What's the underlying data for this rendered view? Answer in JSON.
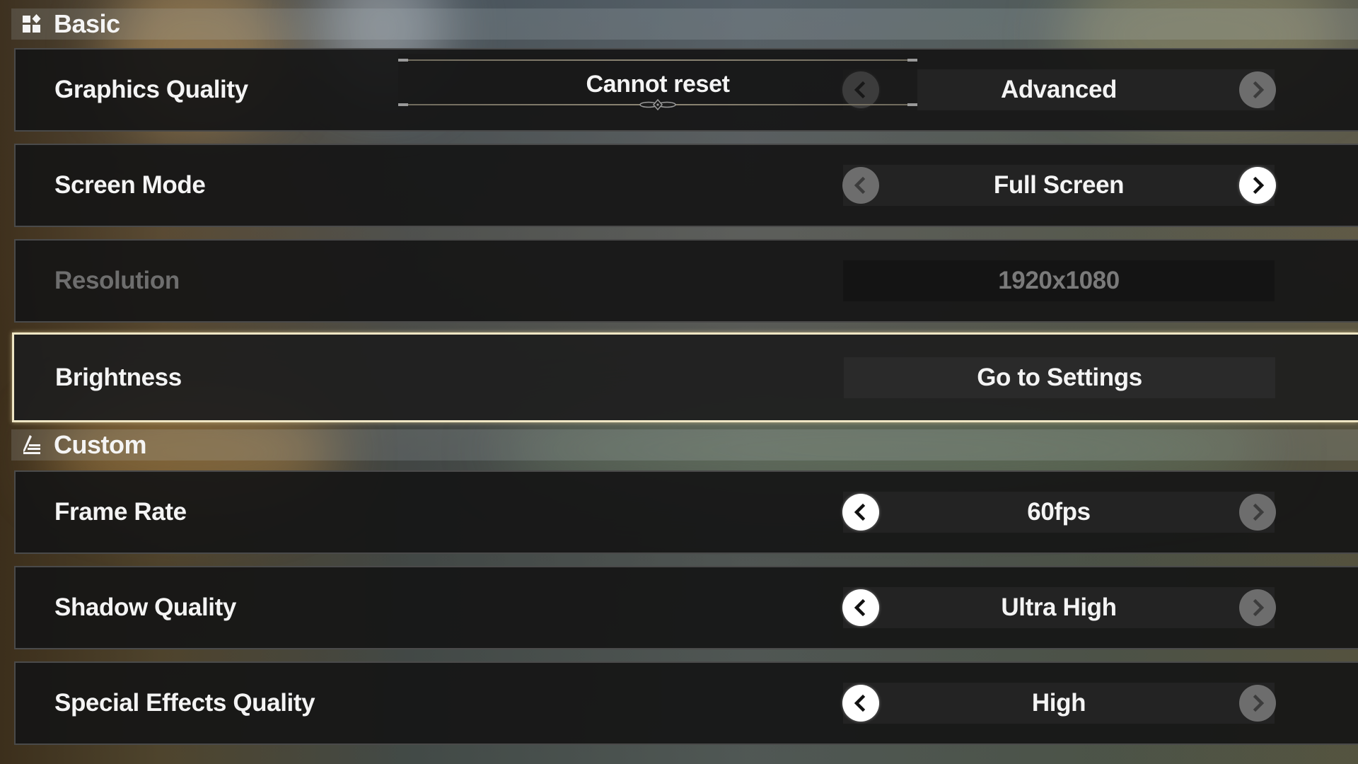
{
  "sections": [
    {
      "title": "Basic",
      "icon": "grid-diamond-icon",
      "rows": [
        {
          "label": "Graphics Quality",
          "type": "selector",
          "value": "Advanced",
          "left_enabled": true,
          "right_enabled": false,
          "tooltip": "Cannot reset"
        },
        {
          "label": "Screen Mode",
          "type": "selector",
          "value": "Full Screen",
          "left_enabled": false,
          "right_enabled": true
        },
        {
          "label": "Resolution",
          "type": "readonly",
          "value": "1920x1080",
          "disabled": true
        },
        {
          "label": "Brightness",
          "type": "button",
          "value": "Go to Settings",
          "selected": true
        }
      ]
    },
    {
      "title": "Custom",
      "icon": "pencil-lines-icon",
      "rows": [
        {
          "label": "Frame Rate",
          "type": "selector",
          "value": "60fps",
          "left_enabled": true,
          "right_enabled": false
        },
        {
          "label": "Shadow Quality",
          "type": "selector",
          "value": "Ultra High",
          "left_enabled": true,
          "right_enabled": false
        },
        {
          "label": "Special Effects Quality",
          "type": "selector",
          "value": "High",
          "left_enabled": true,
          "right_enabled": false
        }
      ]
    }
  ],
  "colors": {
    "highlight_border": "#efe6c4",
    "row_bg": "#161616",
    "arrow_active": "#ffffff",
    "arrow_inactive": "#6d6d6d",
    "disabled_text": "#6e6e6e"
  }
}
